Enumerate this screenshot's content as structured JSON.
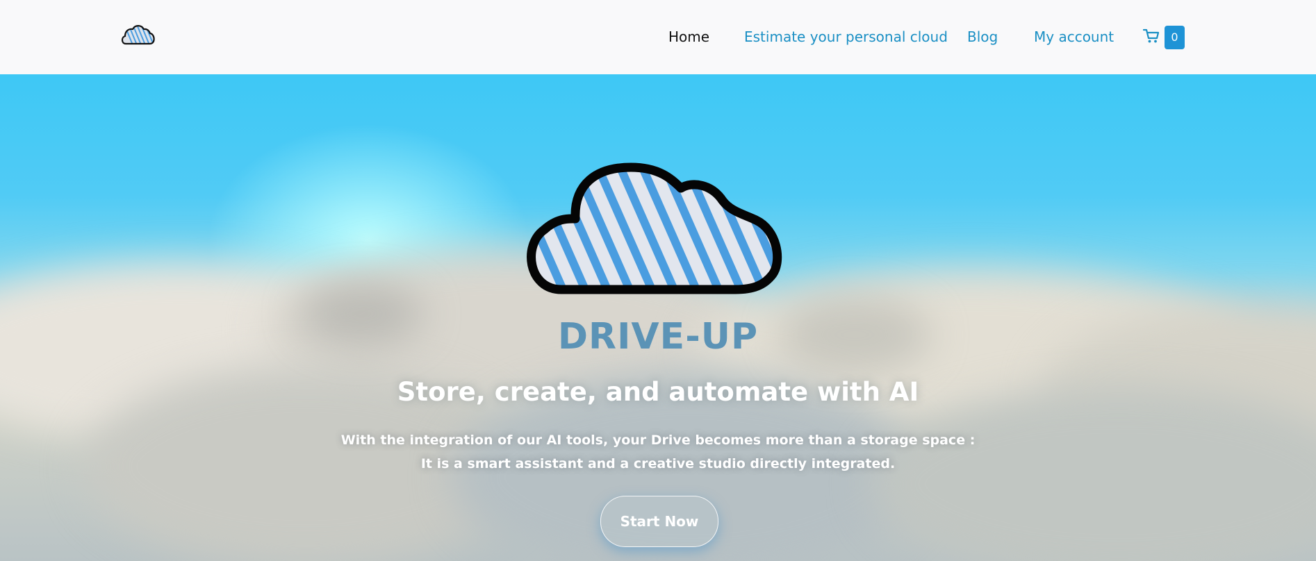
{
  "nav": {
    "home": "Home",
    "estimate": "Estimate your personal cloud",
    "blog": "Blog",
    "account": "My account",
    "cart_count": "0"
  },
  "hero": {
    "brand": "DRIVE-UP",
    "headline": "Store, create, and automate with AI",
    "description_line1": "With the integration of our AI tools, your Drive becomes more than a storage space :",
    "description_line2": "It is a smart assistant and a creative studio directly integrated.",
    "cta": "Start Now"
  },
  "icons": {
    "logo": "cloud-logo-icon",
    "cart": "shopping-cart-icon",
    "hero": "cloud-icon"
  },
  "colors": {
    "accent": "#1a8fc4",
    "badge": "#1e93d6",
    "brand_text": "#5b93b6",
    "stripe_blue": "#4a9de0",
    "cloud_fill": "#e2e6ee"
  }
}
